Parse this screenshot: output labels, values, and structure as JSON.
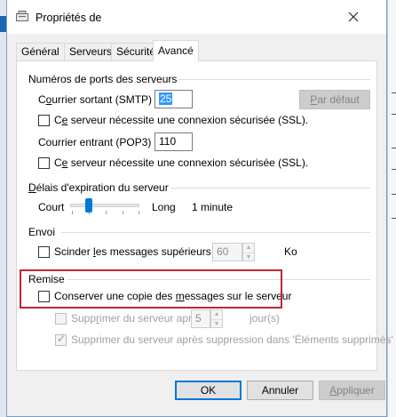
{
  "window": {
    "title": "Propriétés de"
  },
  "tabs": [
    {
      "label": "Général"
    },
    {
      "label": "Serveurs"
    },
    {
      "label": "Sécurité"
    },
    {
      "label": "Avancé",
      "active": true
    }
  ],
  "ports": {
    "legend": "Numéros de ports des serveurs",
    "smtp": {
      "label_pre": "C",
      "label_u": "o",
      "label_post": "urrier sortant (SMTP) :",
      "value": "25"
    },
    "default_button": {
      "label_u": "P",
      "label_post": "ar défaut"
    },
    "ssl_smtp": {
      "label_pre": "C",
      "label_u": "e",
      "label_post": " serveur nécessite une connexion sécurisée (SSL).",
      "checked": false
    },
    "pop3": {
      "label_pre": "Courrier entrant (POP3) :",
      "value": "110"
    },
    "ssl_pop3": {
      "label_pre": "C",
      "label_u": "e",
      "label_post": " serveur nécessite une connexion sécurisée (SSL).",
      "checked": false
    }
  },
  "timeout": {
    "legend_u": "D",
    "legend_post": "élais d'expiration du serveur",
    "short": "Court",
    "long": "Long",
    "value": "1 minute",
    "level": 0.25
  },
  "send": {
    "legend": "Envoi",
    "split": {
      "label_pre": "Scinder ",
      "label_u": "l",
      "label_post": "es messages supérieurs à",
      "checked": false,
      "value": "60",
      "unit": "Ko"
    }
  },
  "delivery": {
    "legend": "Remise",
    "keep_copy": {
      "label_pre": "Conserver une copie des ",
      "label_u": "m",
      "label_post": "essages sur le serveur",
      "checked": false
    },
    "remove_after": {
      "label_pre": "Supp",
      "label_u": "r",
      "label_post": "imer du serveur après",
      "value": "5",
      "unit": "jour(s)",
      "checked": false
    },
    "remove_deleted": {
      "label_pre": "Supprimer du serveur après suppression dans 'Éléments supprimés'",
      "checked": true
    }
  },
  "buttons": {
    "ok": "OK",
    "cancel": "Annuler",
    "apply_u": "A",
    "apply_post": "ppliquer"
  },
  "colors": {
    "accent": "#0078d7",
    "highlight": "#c1272d",
    "selection": "#3399ff"
  }
}
